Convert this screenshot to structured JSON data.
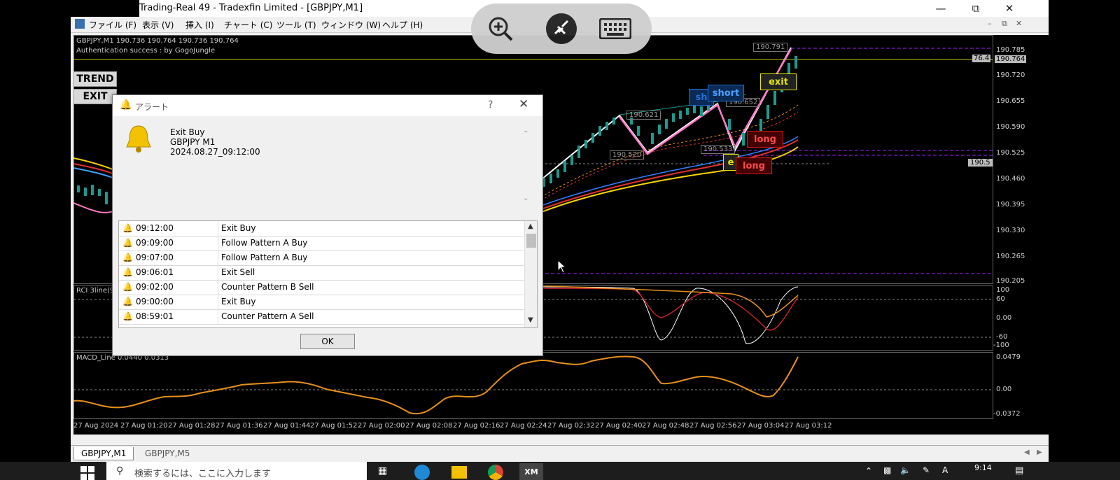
{
  "window": {
    "title": "Trading-Real 49 - Tradexfin Limited - [GBPJPY,M1]",
    "minimize_icon": "minimize-icon",
    "restore_icon": "restore-icon",
    "close_icon": "close-icon"
  },
  "menubar": {
    "items": [
      "ファイル (F)",
      "表示 (V)",
      "挿入 (I)",
      "チャート (C)",
      "ツール (T)",
      "ウィンドウ (W)",
      "ヘルプ (H)"
    ]
  },
  "chart": {
    "header": "GBPJPY,M1  190.736 190.764 190.736 190.764",
    "auth": "Authentication success : by GogoJungle",
    "trend_button": "TREND",
    "exit_button": "EXIT",
    "price_labels": [
      "190.785",
      "190.764",
      "190.720",
      "190.655",
      "190.590",
      "190.525",
      "190.460",
      "190.395",
      "190.330",
      "190.265",
      "190.205"
    ],
    "level_76": "76.4",
    "level_1905": "190.5",
    "annotations": [
      "190.791",
      "190.621",
      "190.652",
      "190.520",
      "190.533"
    ],
    "tags": {
      "short1": "sh",
      "short2": "short",
      "exit": "exit",
      "long1": "long",
      "long2": "long",
      "exit_partial": "e"
    },
    "rci_label": "RCI 3line(9",
    "rci_levels": [
      "100",
      "60",
      "0.00",
      "-60",
      "-100"
    ],
    "macd_label": "MACD_Line 0.0440 0.0313",
    "macd_levels": [
      "0.0479",
      "0.00",
      "-0.0372"
    ],
    "time_labels": [
      "27 Aug 2024",
      "27 Aug 01:20",
      "27 Aug 01:28",
      "27 Aug 01:36",
      "27 Aug 01:44",
      "27 Aug 01:52",
      "27 Aug 02:00",
      "27 Aug 02:08",
      "27 Aug 02:16",
      "27 Aug 02:24",
      "27 Aug 02:32",
      "27 Aug 02:40",
      "27 Aug 02:48",
      "27 Aug 02:56",
      "27 Aug 03:04",
      "27 Aug 03:12"
    ]
  },
  "dialog": {
    "title": "アラート",
    "help": "?",
    "message": {
      "line1": "Exit Buy",
      "line2": "GBPJPY  M1",
      "line3": "2024.08.27_09:12:00"
    },
    "rows": [
      {
        "time": "09:12:00",
        "msg": "Exit Buy"
      },
      {
        "time": "09:09:00",
        "msg": "Follow Pattern A Buy"
      },
      {
        "time": "09:07:00",
        "msg": "Follow Pattern A Buy"
      },
      {
        "time": "09:06:01",
        "msg": "Exit Sell"
      },
      {
        "time": "09:02:00",
        "msg": "Counter Pattern B Sell"
      },
      {
        "time": "09:00:00",
        "msg": "Exit Buy"
      },
      {
        "time": "08:59:01",
        "msg": "Counter Pattern A Sell"
      }
    ],
    "ok": "OK"
  },
  "tabs": [
    "GBPJPY,M1",
    "GBPJPY,M5"
  ],
  "taskbar": {
    "search_placeholder": "検索するには、ここに入力します",
    "clock": "9:14"
  },
  "colors": {
    "accent_orange": "#e8901c",
    "pink": "#ff7ac8",
    "short_blue": "#1e6fd9",
    "long_red": "#d41a1a",
    "exit_yellow": "#e6e600"
  }
}
